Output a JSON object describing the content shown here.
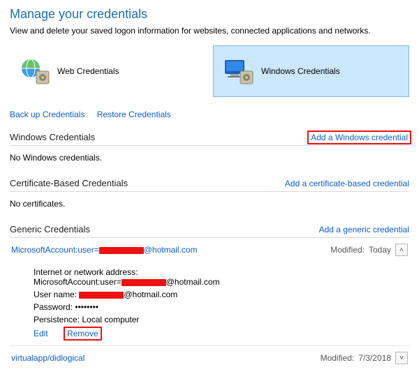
{
  "header": {
    "title": "Manage your credentials",
    "description": "View and delete your saved logon information for websites, connected applications and networks."
  },
  "tiles": {
    "web": "Web Credentials",
    "windows": "Windows Credentials"
  },
  "links": {
    "backup": "Back up Credentials",
    "restore": "Restore Credentials"
  },
  "sections": {
    "windows": {
      "name": "Windows Credentials",
      "add": "Add a Windows credential",
      "empty": "No Windows credentials."
    },
    "cert": {
      "name": "Certificate-Based Credentials",
      "add": "Add a certificate-based credential",
      "empty": "No certificates."
    },
    "generic": {
      "name": "Generic Credentials",
      "add": "Add a generic credential"
    }
  },
  "entries": [
    {
      "title_prefix": "MicrosoftAccount:user=",
      "title_suffix": "@hotmail.com",
      "modified_label": "Modified:",
      "modified_value": "Today",
      "expanded": true,
      "details": {
        "address_label": "Internet or network address:",
        "address_prefix": "MicrosoftAccount:user=",
        "address_suffix": "@hotmail.com",
        "username_label": "User name:",
        "username_suffix": "@hotmail.com",
        "password_label": "Password:",
        "password_value": "••••••••",
        "persistence_label": "Persistence:",
        "persistence_value": "Local computer",
        "edit": "Edit",
        "remove": "Remove"
      }
    },
    {
      "title": "virtualapp/didlogical",
      "modified_label": "Modified:",
      "modified_value": "7/3/2018",
      "expanded": false
    }
  ]
}
